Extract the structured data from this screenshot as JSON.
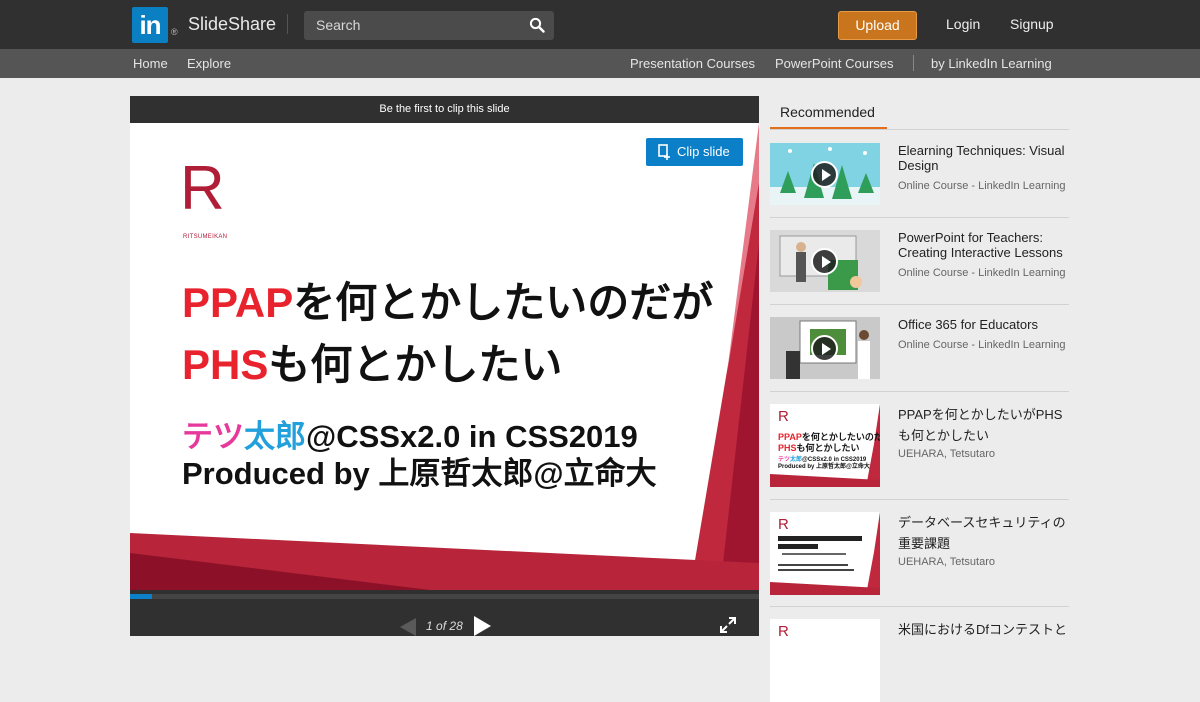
{
  "header": {
    "logo_mark": "in",
    "logo_reg": "®",
    "app_name": "SlideShare",
    "search_placeholder": "Search",
    "upload_label": "Upload",
    "login_label": "Login",
    "signup_label": "Signup"
  },
  "subnav": {
    "home": "Home",
    "explore": "Explore",
    "presentation_courses": "Presentation Courses",
    "powerpoint_courses": "PowerPoint Courses",
    "linkedin_learning": "by LinkedIn Learning"
  },
  "player": {
    "clip_banner": "Be the first to clip this slide",
    "clip_button": "Clip slide",
    "page_current": "1",
    "page_of": "of",
    "page_total": "28",
    "progress": 0.0357,
    "slide": {
      "logo_letter": "R",
      "logo_caption": "RITSUMEIKAN",
      "line1_a": "PPAP",
      "line1_b": "を何とかしたいのだが",
      "line2_a": "PHS",
      "line2_b": "も何とかしたい",
      "line3_a": "テツ",
      "line3_b": "太郎",
      "line3_c": "@CSSx2.0 in CSS2019",
      "line4": "Produced by 上原哲太郎@立命大"
    }
  },
  "recommended": {
    "tab_label": "Recommended",
    "items": [
      {
        "title": "Elearning Techniques: Visual Design",
        "subtitle": "Online Course - LinkedIn Learning",
        "type": "video"
      },
      {
        "title": "PowerPoint for Teachers: Creating Interactive Lessons",
        "subtitle": "Online Course - LinkedIn Learning",
        "type": "video"
      },
      {
        "title": "Office 365 for Educators",
        "subtitle": "Online Course - LinkedIn Learning",
        "type": "video"
      },
      {
        "title": "PPAPを何とかしたいがPHSも何とかしたい",
        "subtitle": "UEHARA, Tetsutaro",
        "type": "slide"
      },
      {
        "title": "データベースセキュリティの重要課題",
        "subtitle": "UEHARA, Tetsutaro",
        "type": "slide"
      },
      {
        "title": "米国におけるDfコンテストと",
        "subtitle": "",
        "type": "slide"
      }
    ]
  },
  "colors": {
    "accent_blue": "#0b7fc7",
    "upload_orange": "#c9751d",
    "tab_underline": "#e36f1d",
    "slide_red": "#e8232d",
    "slide_crimson": "#b01d36"
  }
}
